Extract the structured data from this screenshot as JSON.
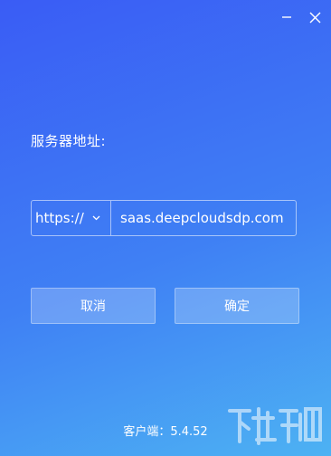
{
  "window": {
    "minimize_icon": "minimize-icon",
    "close_icon": "close-icon",
    "gradient_start": "#3a5cf5",
    "gradient_end": "#4db2f3"
  },
  "server": {
    "label": "服务器地址:",
    "protocol": "https://",
    "protocol_icon": "chevron-down-icon",
    "host": "saas.deepcloudsdp.com"
  },
  "buttons": {
    "cancel_label": "取消",
    "confirm_label": "确定"
  },
  "footer": {
    "version": "客户端：5.4.52"
  }
}
